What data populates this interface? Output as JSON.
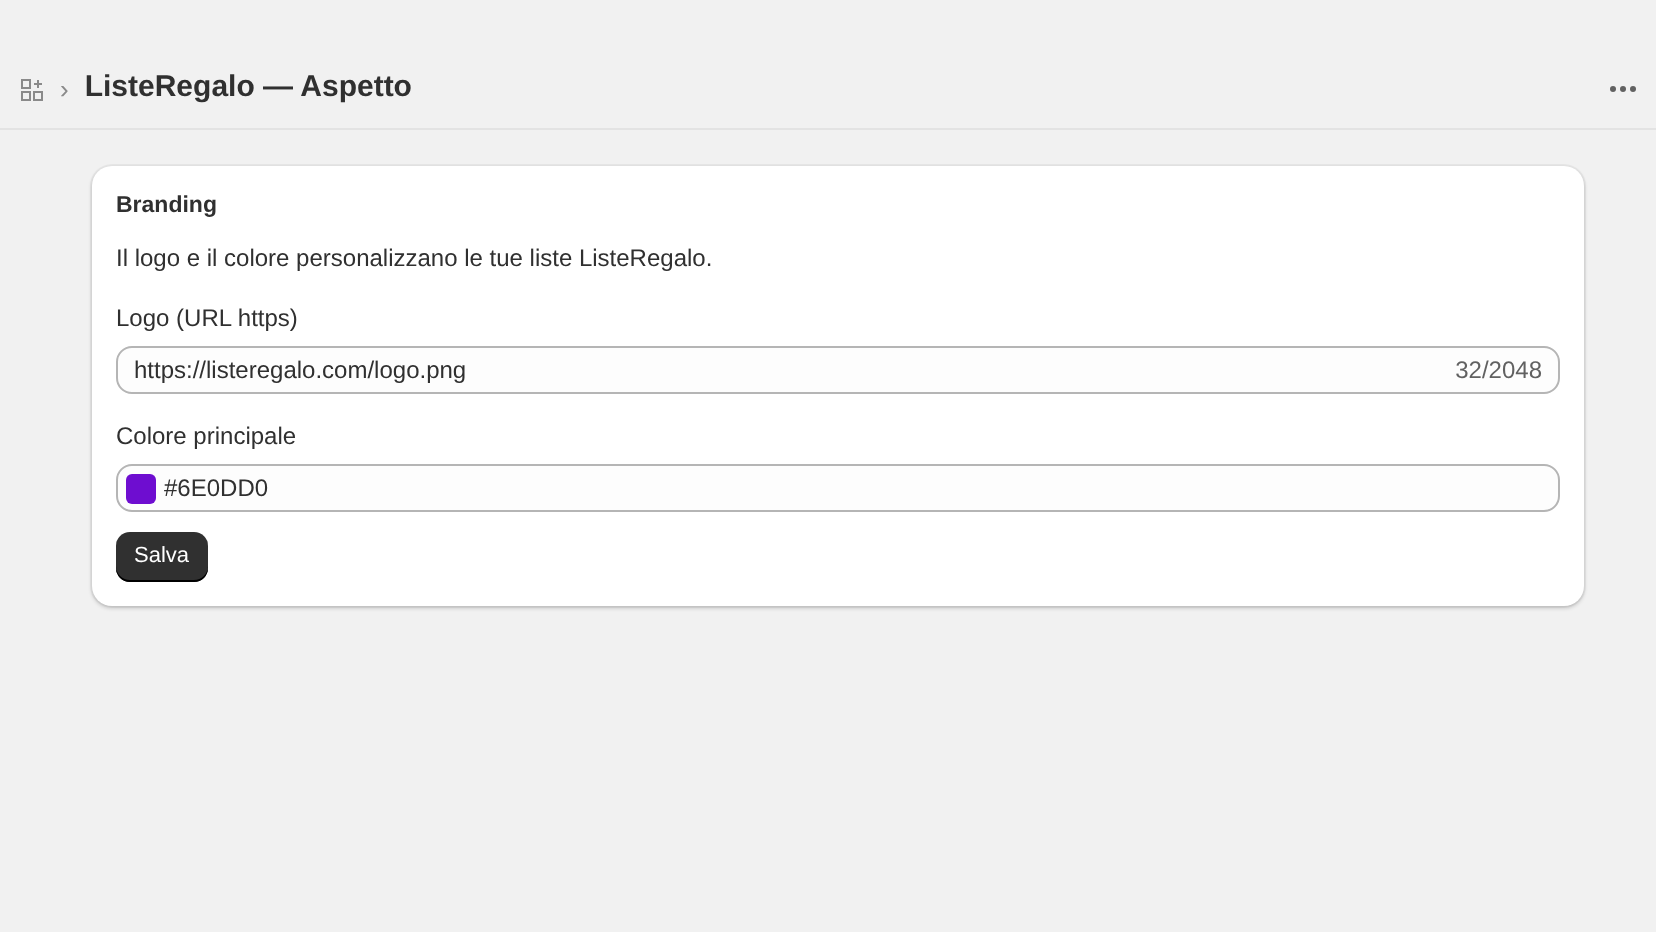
{
  "header": {
    "title": "ListeRegalo — Aspetto",
    "separator": "›"
  },
  "card": {
    "heading": "Branding",
    "description": "Il logo e il colore personalizzano le tue liste ListeRegalo.",
    "fields": [
      {
        "kind": "text",
        "label": "Logo (URL https)",
        "value": "https://listeregalo.com/logo.png",
        "counter": "32/2048"
      },
      {
        "kind": "color",
        "label": "Colore principale",
        "value": "#6E0DD0"
      }
    ],
    "button": "Salva"
  }
}
